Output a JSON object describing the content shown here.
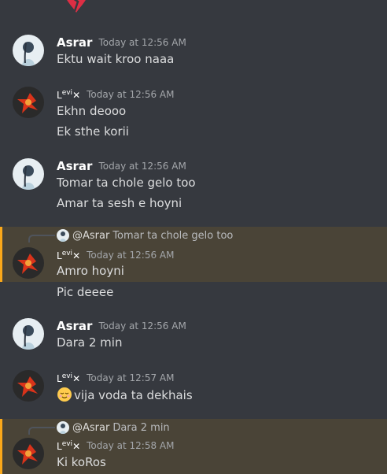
{
  "messages": [
    {
      "author": "Asrar",
      "time": "Today at 12:56 AM",
      "lines": [
        "Ektu wait kroo naaa"
      ]
    },
    {
      "author_main": "L",
      "author_sup": "evi",
      "author_tail": "✕",
      "time": "Today at 12:56 AM",
      "lines": [
        "Ekhn deooo",
        "Ek sthe korii"
      ]
    },
    {
      "author": "Asrar",
      "time": "Today at 12:56 AM",
      "lines": [
        "Tomar ta chole gelo too",
        "Amar ta sesh e hoyni"
      ]
    },
    {
      "reply": {
        "name": "@Asrar",
        "text": "Tomar ta chole gelo too"
      },
      "author_main": "L",
      "author_sup": "evi",
      "author_tail": "✕",
      "time": "Today at 12:56 AM",
      "lines": [
        "Amro hoyni"
      ]
    },
    {
      "lines": [
        "Pic deeee"
      ]
    },
    {
      "author": "Asrar",
      "time": "Today at 12:56 AM",
      "lines": [
        "Dara 2 min"
      ]
    },
    {
      "author_main": "L",
      "author_sup": "evi",
      "author_tail": "✕",
      "time": "Today at 12:57 AM",
      "lines": [
        "vija voda ta dekhais"
      ],
      "emoji": "relieved-face"
    },
    {
      "reply": {
        "name": "@Asrar",
        "text": "Dara 2 min"
      },
      "author_main": "L",
      "author_sup": "evi",
      "author_tail": "✕",
      "time": "Today at 12:58 AM",
      "lines": [
        "Ki koRos"
      ]
    }
  ],
  "colors": {
    "background": "#36393f",
    "mention_highlight": "#4a4437",
    "mention_bar": "#faa81a",
    "timestamp": "#a3a6aa",
    "text": "#dcddde"
  }
}
